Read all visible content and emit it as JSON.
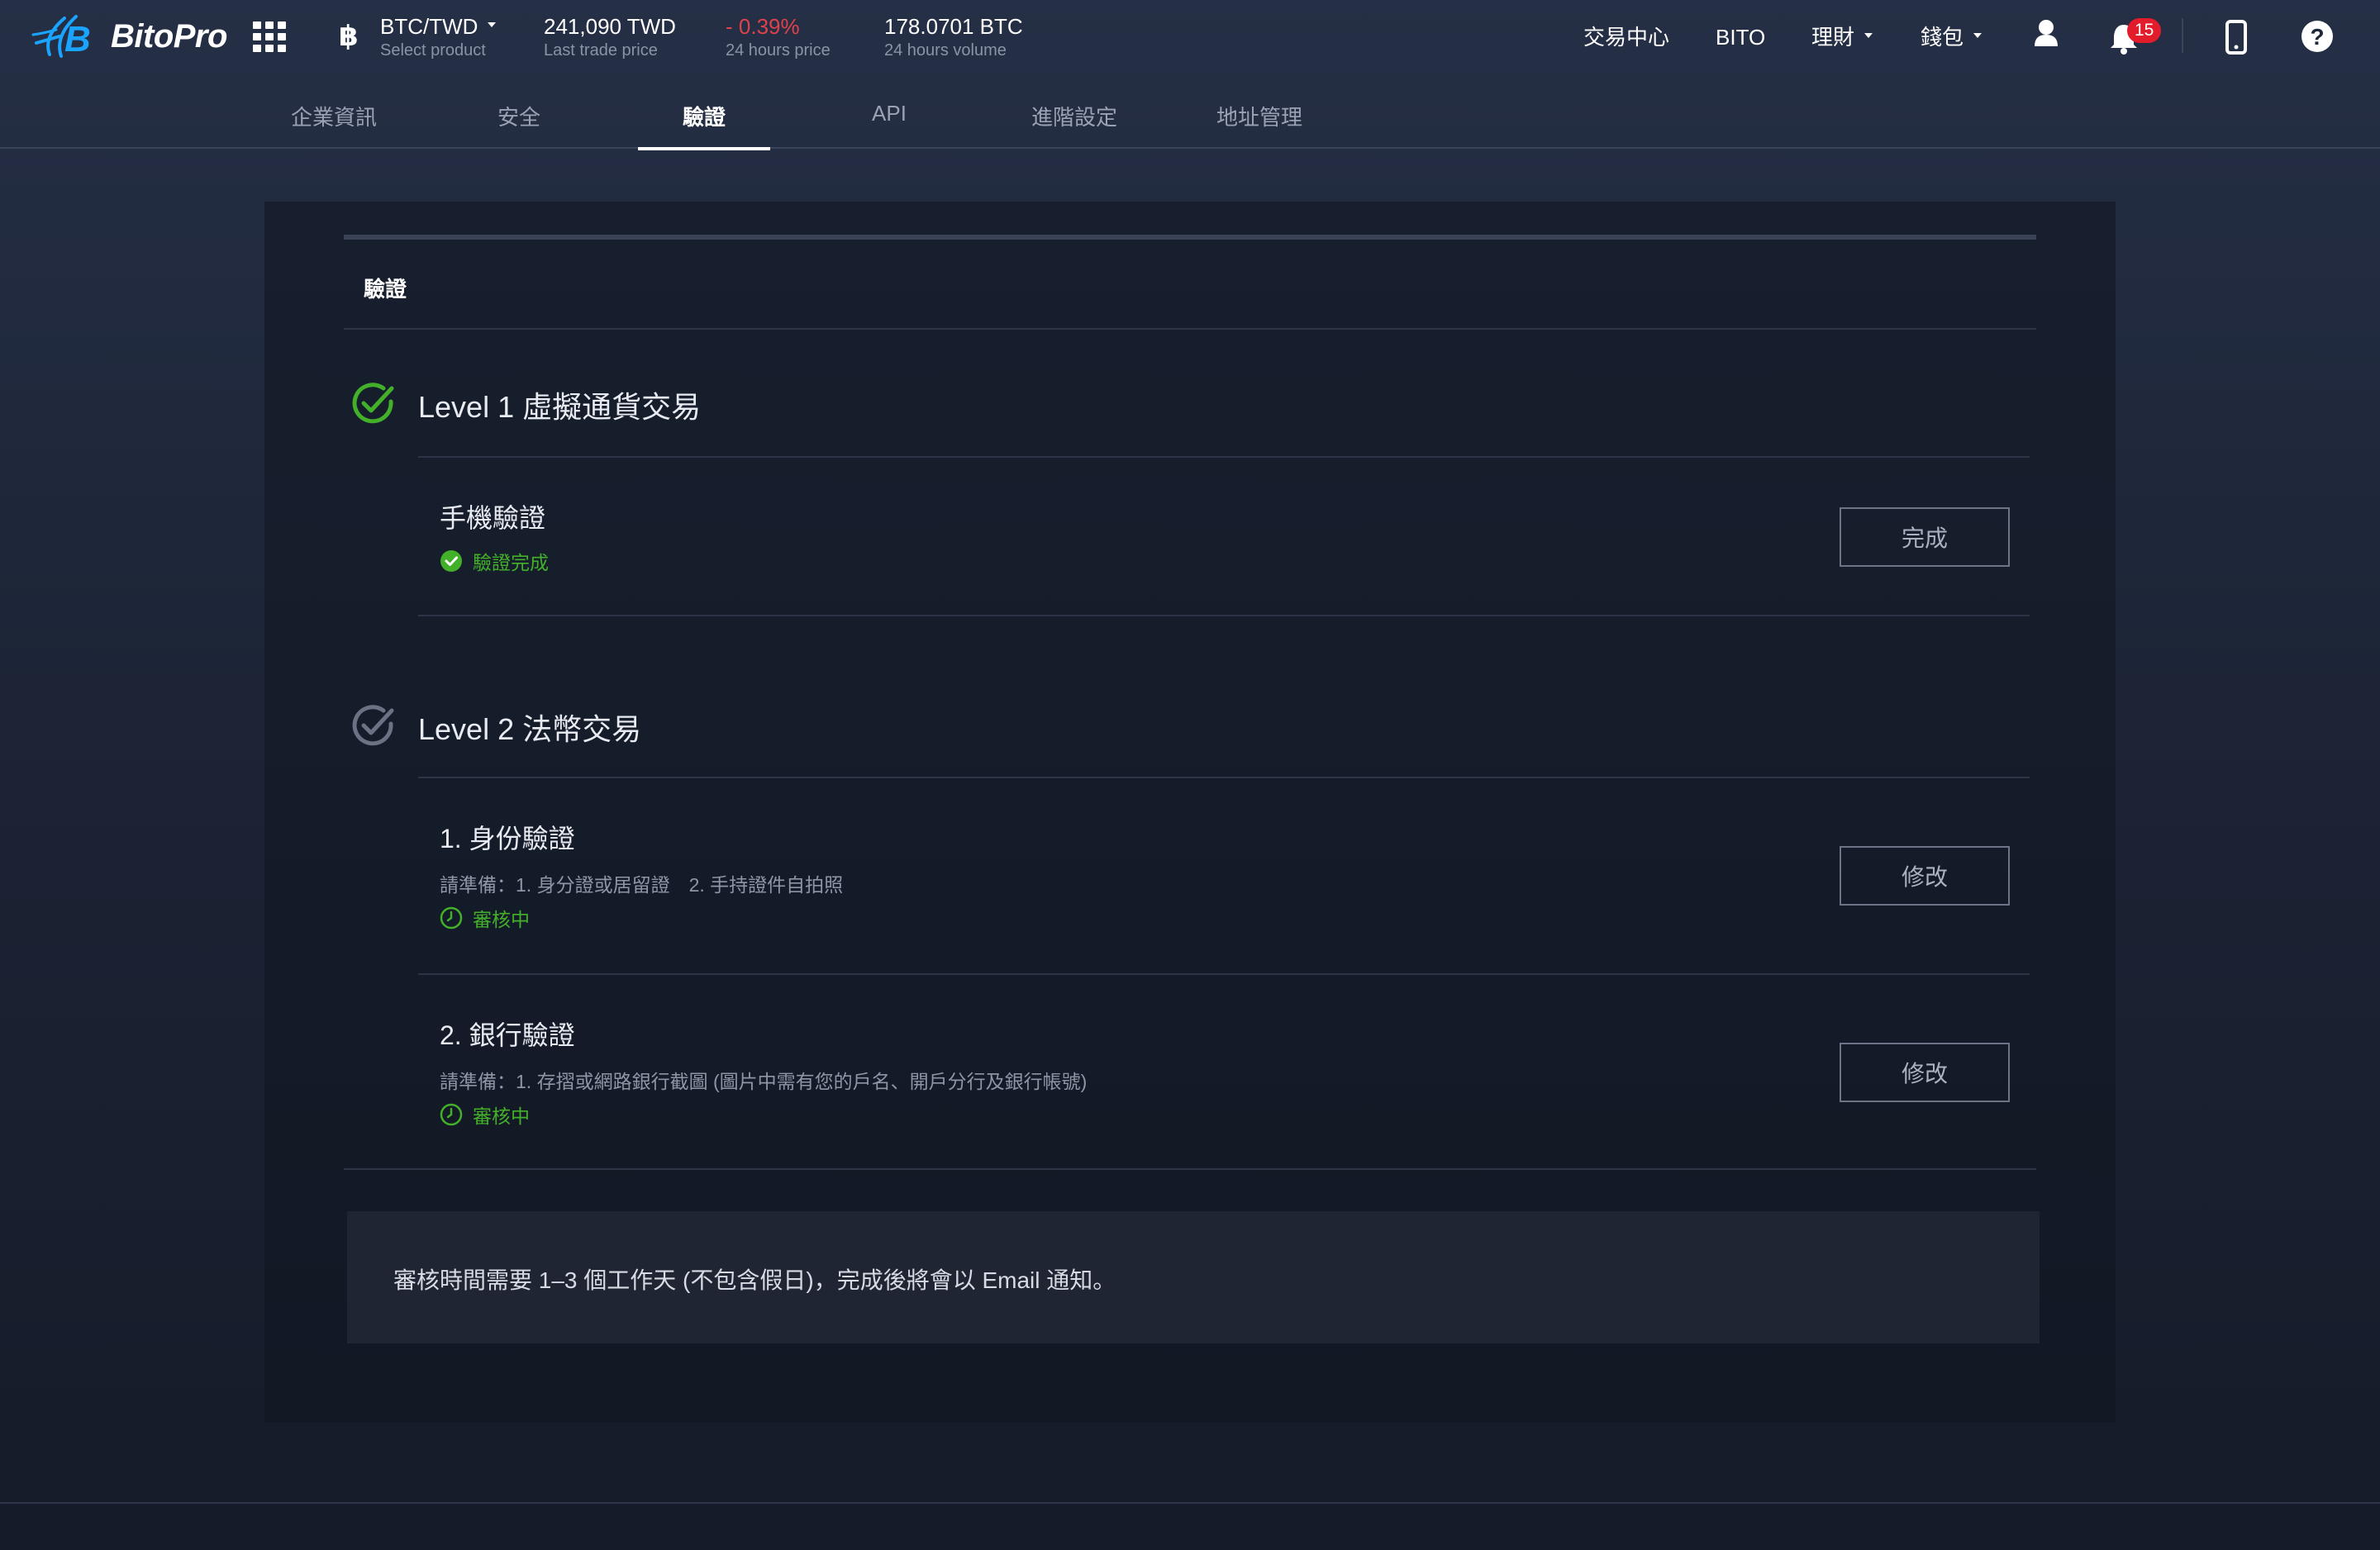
{
  "brand": {
    "name": "BitoPro",
    "accent": "#1aa3ff"
  },
  "ticker": {
    "pair": "BTC/TWD",
    "pair_label": "Select product",
    "last_price": "241,090 TWD",
    "last_price_label": "Last trade price",
    "change": "- 0.39%",
    "change_label": "24 hours price",
    "volume": "178.0701 BTC",
    "volume_label": "24 hours volume",
    "coin_symbol": "฿"
  },
  "nav": {
    "trade_center": "交易中心",
    "bito": "BITO",
    "finance": "理財",
    "wallet": "錢包",
    "notification_count": "15"
  },
  "tabs": [
    {
      "label": "企業資訊"
    },
    {
      "label": "安全"
    },
    {
      "label": "驗證",
      "active": true
    },
    {
      "label": "API"
    },
    {
      "label": "進階設定"
    },
    {
      "label": "地址管理"
    }
  ],
  "card": {
    "title": "驗證",
    "level1": {
      "title": "Level 1 虛擬通貨交易",
      "items": [
        {
          "title": "手機驗證",
          "status": "驗證完成",
          "button": "完成"
        }
      ]
    },
    "level2": {
      "title": "Level 2 法幣交易",
      "items": [
        {
          "title": "1. 身份驗證",
          "desc": "請準備：1. 身分證或居留證　2. 手持證件自拍照",
          "status": "審核中",
          "button": "修改"
        },
        {
          "title": "2. 銀行驗證",
          "desc": "請準備：1. 存摺或網路銀行截圖 (圖片中需有您的戶名、開戶分行及銀行帳號)",
          "status": "審核中",
          "button": "修改"
        }
      ]
    },
    "notice": "審核時間需要 1–3 個工作天 (不包含假日)，完成後將會以 Email 通知。"
  },
  "colors": {
    "success": "#43b02a",
    "negative": "#e0424d",
    "badge": "#e21c2b"
  }
}
